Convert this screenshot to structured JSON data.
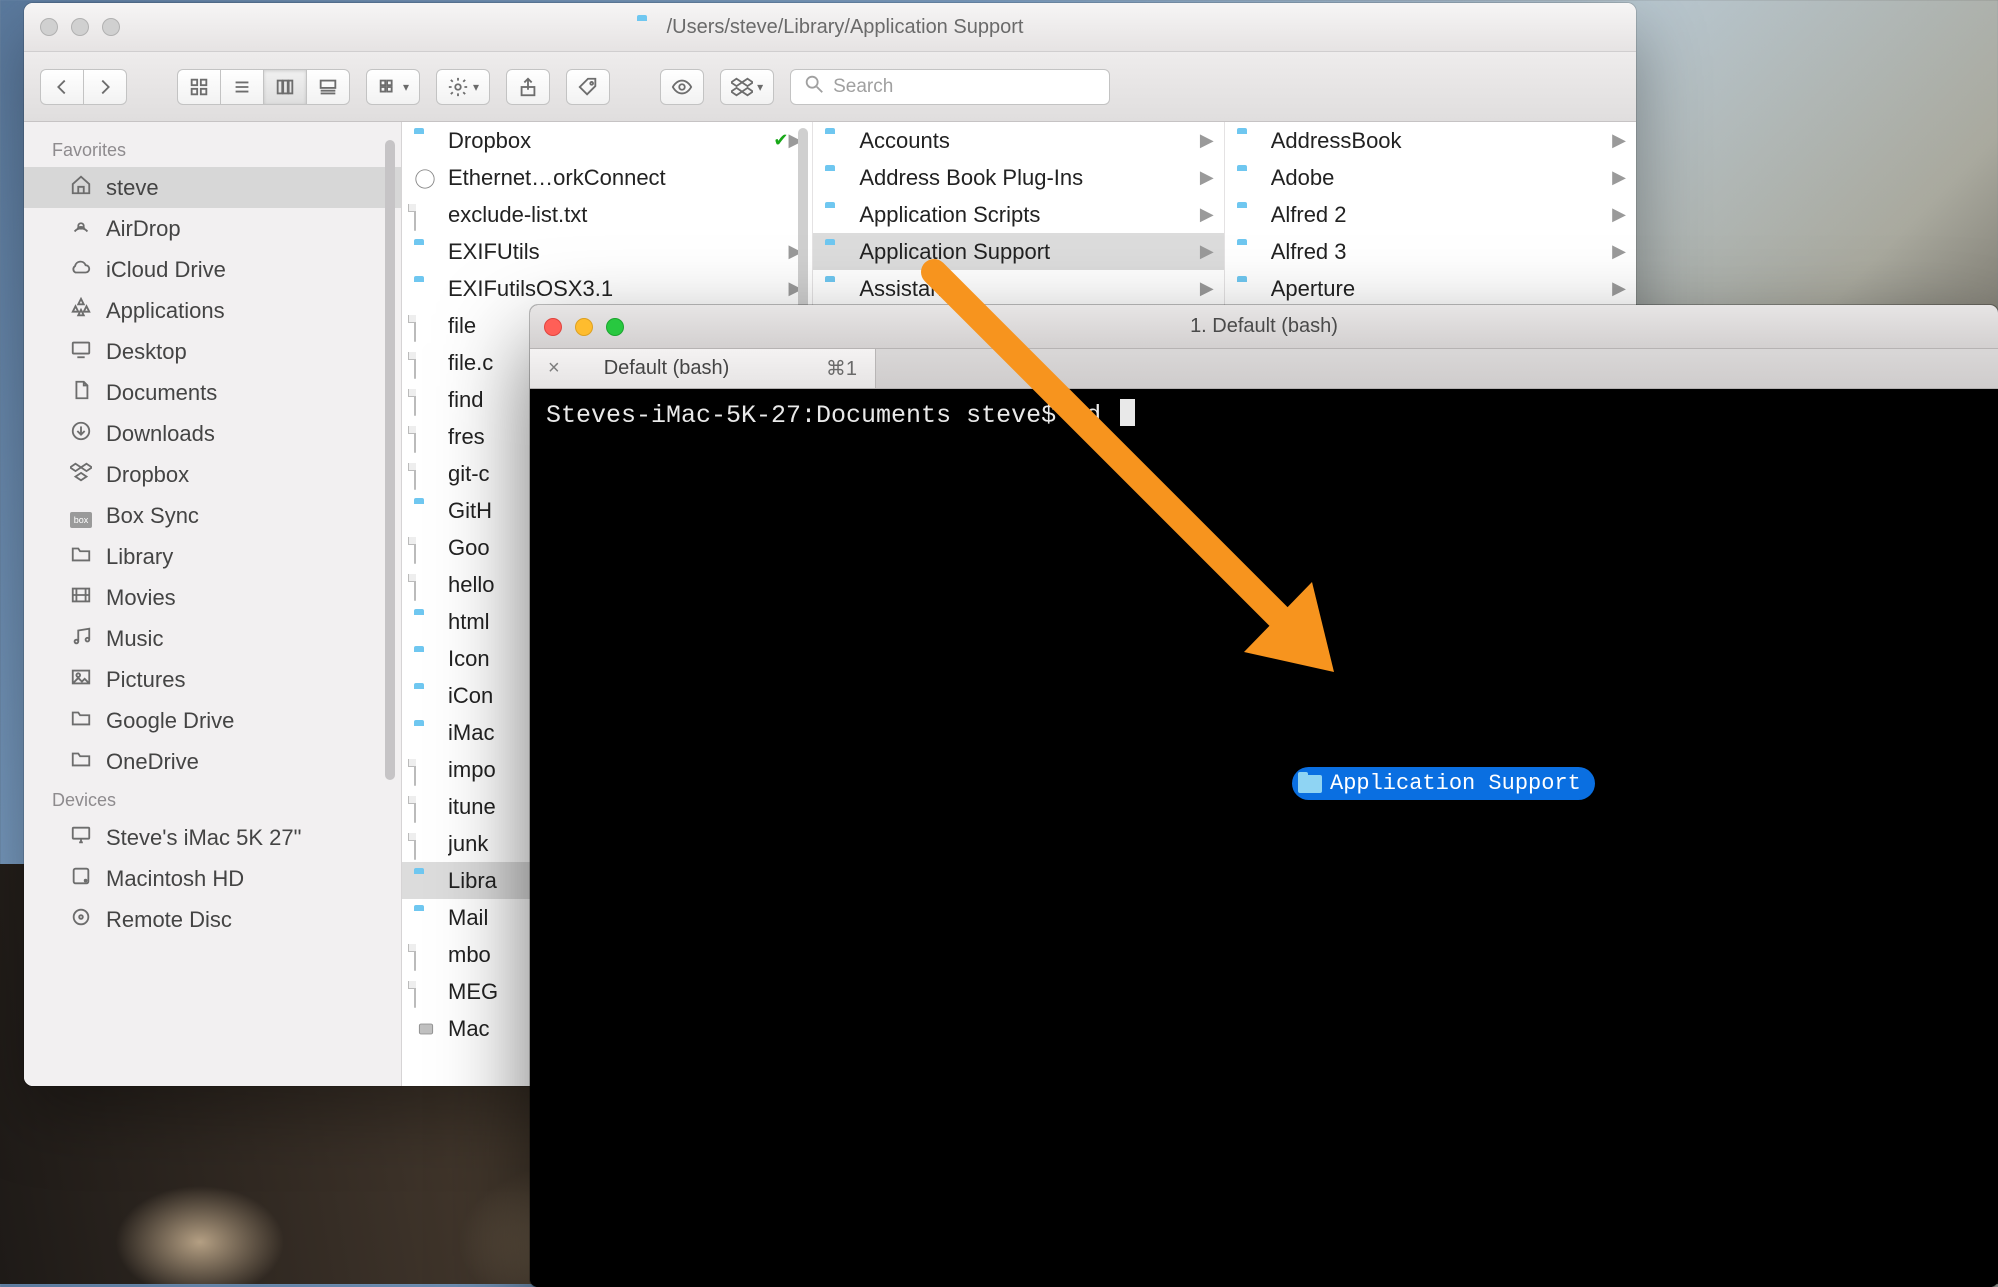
{
  "finder": {
    "title_path": "/Users/steve/Library/Application Support",
    "toolbar": {
      "search_placeholder": "Search"
    },
    "sidebar": {
      "sections": [
        {
          "title": "Favorites",
          "items": [
            {
              "icon": "home",
              "label": "steve",
              "selected": true
            },
            {
              "icon": "airdrop",
              "label": "AirDrop",
              "selected": false
            },
            {
              "icon": "cloud",
              "label": "iCloud Drive",
              "selected": false
            },
            {
              "icon": "apps",
              "label": "Applications",
              "selected": false
            },
            {
              "icon": "desktop",
              "label": "Desktop",
              "selected": false
            },
            {
              "icon": "documents",
              "label": "Documents",
              "selected": false
            },
            {
              "icon": "downloads",
              "label": "Downloads",
              "selected": false
            },
            {
              "icon": "dropbox",
              "label": "Dropbox",
              "selected": false
            },
            {
              "icon": "box",
              "label": "Box Sync",
              "selected": false
            },
            {
              "icon": "folder",
              "label": "Library",
              "selected": false
            },
            {
              "icon": "movies",
              "label": "Movies",
              "selected": false
            },
            {
              "icon": "music",
              "label": "Music",
              "selected": false
            },
            {
              "icon": "pictures",
              "label": "Pictures",
              "selected": false
            },
            {
              "icon": "folder",
              "label": "Google Drive",
              "selected": false
            },
            {
              "icon": "folder",
              "label": "OneDrive",
              "selected": false
            }
          ]
        },
        {
          "title": "Devices",
          "items": [
            {
              "icon": "imac",
              "label": "Steve's iMac 5K 27\"",
              "selected": false
            },
            {
              "icon": "disk",
              "label": "Macintosh HD",
              "selected": false
            },
            {
              "icon": "remote",
              "label": "Remote Disc",
              "selected": false
            }
          ]
        }
      ]
    },
    "columns": [
      {
        "items": [
          {
            "kind": "folder",
            "name": "Dropbox",
            "synced": true,
            "arrow": true
          },
          {
            "kind": "app",
            "name": "Ethernet…orkConnect",
            "arrow": false
          },
          {
            "kind": "file",
            "name": "exclude-list.txt",
            "arrow": false
          },
          {
            "kind": "folder",
            "name": "EXIFUtils",
            "arrow": true
          },
          {
            "kind": "folder",
            "name": "EXIFutilsOSX3.1",
            "arrow": true
          },
          {
            "kind": "file",
            "name": "file",
            "arrow": false
          },
          {
            "kind": "file",
            "name": "file.c",
            "arrow": false
          },
          {
            "kind": "file",
            "name": "find",
            "arrow": false
          },
          {
            "kind": "file",
            "name": "fres",
            "arrow": false
          },
          {
            "kind": "file",
            "name": "git-c",
            "arrow": false
          },
          {
            "kind": "folder",
            "name": "GitH",
            "arrow": false
          },
          {
            "kind": "file",
            "name": "Goo",
            "arrow": false
          },
          {
            "kind": "file",
            "name": "hello",
            "arrow": false
          },
          {
            "kind": "folder",
            "name": "html",
            "arrow": false
          },
          {
            "kind": "folder",
            "name": "Icon",
            "arrow": false
          },
          {
            "kind": "folder",
            "name": "iCon",
            "arrow": false
          },
          {
            "kind": "folder",
            "name": "iMac",
            "arrow": false
          },
          {
            "kind": "file",
            "name": "impo",
            "arrow": false
          },
          {
            "kind": "file",
            "name": "itune",
            "arrow": false
          },
          {
            "kind": "file",
            "name": "junk",
            "arrow": false
          },
          {
            "kind": "folder",
            "name": "Libra",
            "arrow": false,
            "selected": true
          },
          {
            "kind": "folder",
            "name": "Mail",
            "arrow": false
          },
          {
            "kind": "file",
            "name": "mbo",
            "arrow": false
          },
          {
            "kind": "file",
            "name": "MEG",
            "arrow": false
          },
          {
            "kind": "disk",
            "name": "Mac",
            "arrow": false
          }
        ]
      },
      {
        "items": [
          {
            "kind": "folder",
            "name": "Accounts",
            "arrow": true
          },
          {
            "kind": "folder",
            "name": "Address Book Plug-Ins",
            "arrow": true
          },
          {
            "kind": "folder",
            "name": "Application Scripts",
            "arrow": true
          },
          {
            "kind": "folder",
            "name": "Application Support",
            "arrow": true,
            "selected": true
          },
          {
            "kind": "folder",
            "name": "Assistant",
            "arrow": true
          }
        ]
      },
      {
        "items": [
          {
            "kind": "folder",
            "name": "AddressBook",
            "arrow": true
          },
          {
            "kind": "folder",
            "name": "Adobe",
            "arrow": true
          },
          {
            "kind": "folder",
            "name": "Alfred 2",
            "arrow": true
          },
          {
            "kind": "folder",
            "name": "Alfred 3",
            "arrow": true
          },
          {
            "kind": "folder",
            "name": "Aperture",
            "arrow": true
          }
        ]
      }
    ]
  },
  "terminal": {
    "title": "1. Default (bash)",
    "tab": {
      "label": "Default (bash)",
      "shortcut": "⌘1"
    },
    "prompt": "Steves-iMac-5K-27:Documents steve$ cd ",
    "drag_label": "Application Support"
  }
}
